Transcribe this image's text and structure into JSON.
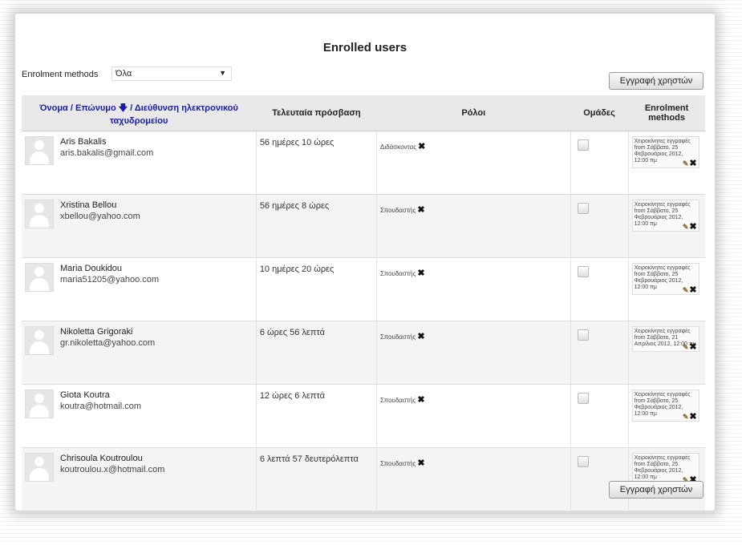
{
  "title": "Enrolled users",
  "enrolment": {
    "label": "Enrolment methods",
    "selected": "Όλα"
  },
  "enrol_button_label": "Εγγραφή χρηστών",
  "table": {
    "headers": {
      "name_first": "Όνομα",
      "name_sep": " / ",
      "name_last": "Επώνυμο",
      "sort_arrow": "🡇",
      "name_email": "Διεύθυνση ηλεκτρονικού ταχυδρομείου",
      "last_access": "Τελευταία πρόσβαση",
      "roles": "Ρόλοι",
      "groups": "Ομάδες",
      "methods": "Enrolment methods"
    },
    "rows": [
      {
        "name": "Aris Bakalis",
        "email": "aris.bakalis@gmail.com",
        "last_access": "56 ημέρες 10 ώρες",
        "role": "Διδάσκοντας",
        "method": "Χειροκίνητες εγγραφές from Σάββατο, 25 Φεβρουάριος 2012, 12:00 πμ"
      },
      {
        "name": "Xristina Bellou",
        "email": "xbellou@yahoo.com",
        "last_access": "56 ημέρες 8 ώρες",
        "role": "Σπουδαστής",
        "method": "Χειροκίνητες εγγραφές from Σάββατο, 25 Φεβρουάριος 2012, 12:00 πμ"
      },
      {
        "name": "Maria Doukidou",
        "email": "maria51205@yahoo.com",
        "last_access": "10 ημέρες 20 ώρες",
        "role": "Σπουδαστής",
        "method": "Χειροκίνητες εγγραφές from Σάββατο, 25 Φεβρουάριος 2012, 12:00 πμ"
      },
      {
        "name": "Nikoletta Grigoraki",
        "email": "gr.nikoletta@yahoo.com",
        "last_access": "6 ώρες 56 λεπτά",
        "role": "Σπουδαστής",
        "method": "Χειροκίνητες εγγραφές from Σάββατο, 21 Απρίλιος 2012, 12:00 πμ"
      },
      {
        "name": "Giota Koutra",
        "email": "koutra@hotmail.com",
        "last_access": "12 ώρες 6 λεπτά",
        "role": "Σπουδαστής",
        "method": "Χειροκίνητες εγγραφές from Σάββατο, 25 Φεβρουάριος 2012, 12:00 πμ"
      },
      {
        "name": "Chrisoula Koutroulou",
        "email": "koutroulou.x@hotmail.com",
        "last_access": "6 λεπτά 57 δευτερόλεπτα",
        "role": "Σπουδαστής",
        "method": "Χειροκίνητες εγγραφές from Σάββατο, 25 Φεβρουάριος 2012, 12:00 πμ"
      }
    ]
  },
  "icons": {
    "remove": "✖",
    "edit": "✎",
    "dropdown": "▼"
  },
  "colors": {
    "link": "#1a1aa6",
    "header_bg": "#e9e9e9"
  }
}
